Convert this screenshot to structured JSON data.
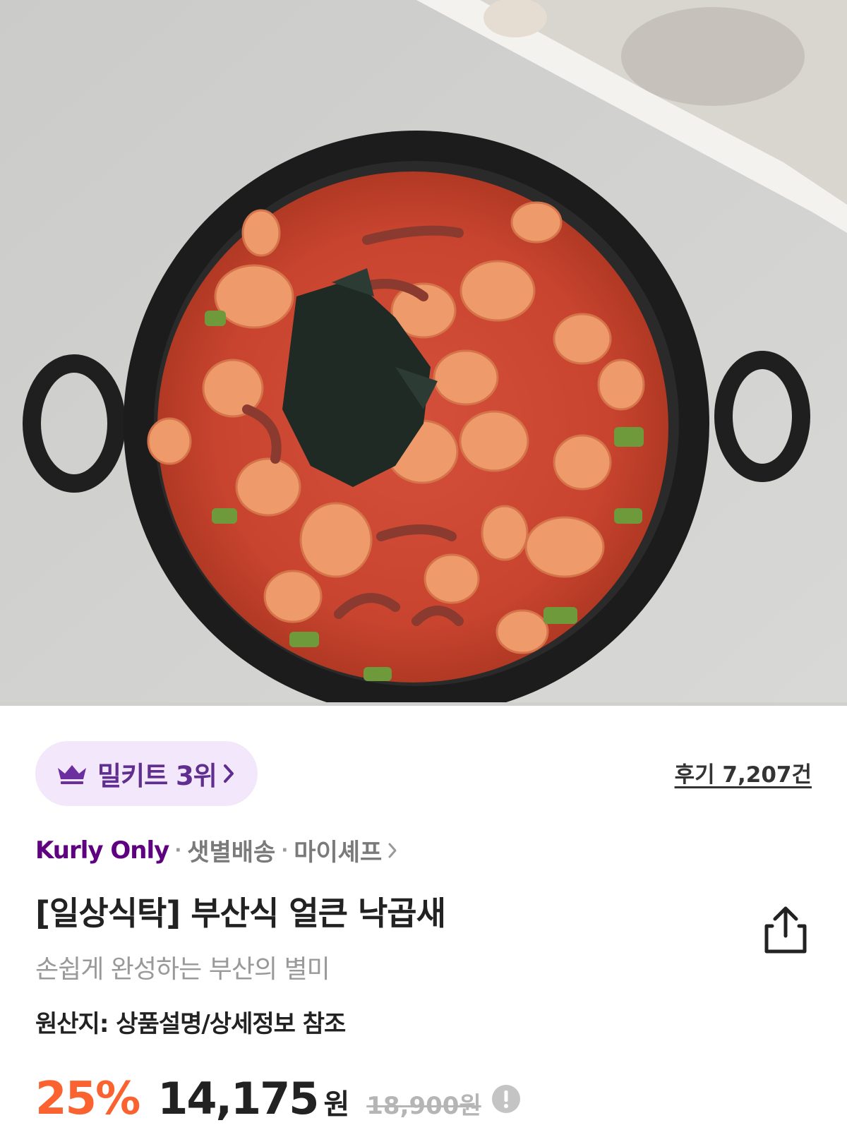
{
  "colors": {
    "brand_purple": "#5f0080",
    "badge_bg": "#f2e7fb",
    "discount_orange": "#fa622f",
    "muted_gray": "#999999"
  },
  "hero": {
    "icon": "food-photo"
  },
  "rank_badge": {
    "label": "밀키트 3위",
    "icon": "crown-icon"
  },
  "reviews": {
    "label": "후기 7,207건"
  },
  "meta": {
    "brand": "Kurly Only",
    "delivery": "샛별배송",
    "partner": "마이셰프"
  },
  "product": {
    "title": "[일상식탁] 부산식 얼큰 낙곱새",
    "subtitle": "손쉽게 완성하는 부산의 별미",
    "origin": "원산지: 상품설명/상세정보 참조"
  },
  "price": {
    "discount": "25%",
    "sale_price": "14,175",
    "currency": "원",
    "original_price": "18,900원"
  }
}
